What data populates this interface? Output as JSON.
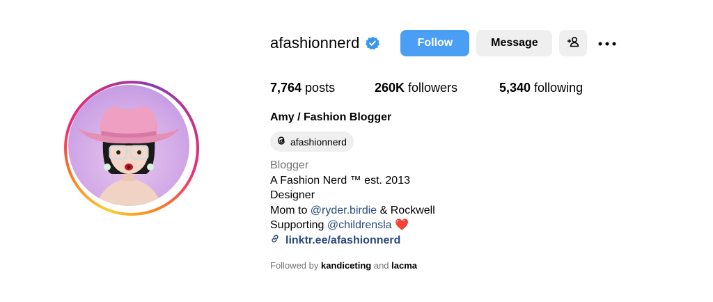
{
  "profile": {
    "username": "afashionnerd",
    "verified_icon": "verified-badge-icon",
    "follow_label": "Follow",
    "message_label": "Message",
    "add_user_icon": "add-user-icon",
    "more_icon": "more-options-icon"
  },
  "stats": {
    "posts_count": "7,764",
    "posts_label": "posts",
    "followers_count": "260K",
    "followers_label": "followers",
    "following_count": "5,340",
    "following_label": "following"
  },
  "bio": {
    "full_name": "Amy / Fashion Blogger",
    "threads_handle": "afashionnerd",
    "category": "Blogger",
    "line1": "A Fashion Nerd ™ est. 2013",
    "line2": "Designer",
    "line3_prefix": "Mom to ",
    "line3_mention": "@ryder.birdie",
    "line3_suffix": " & Rockwell",
    "line4_prefix": "Supporting ",
    "line4_mention": "@childrensla",
    "line4_emoji": "❤️",
    "link": "linktr.ee/afashionnerd"
  },
  "followed_by": {
    "prefix": "Followed by ",
    "user1": "kandiceting",
    "conjunction": " and ",
    "user2": "lacma"
  },
  "colors": {
    "follow_button": "#4a9ff5",
    "secondary_button": "#efefef",
    "mention_link": "#2b4a7e",
    "muted_text": "#737373",
    "verified": "#3897f0"
  }
}
